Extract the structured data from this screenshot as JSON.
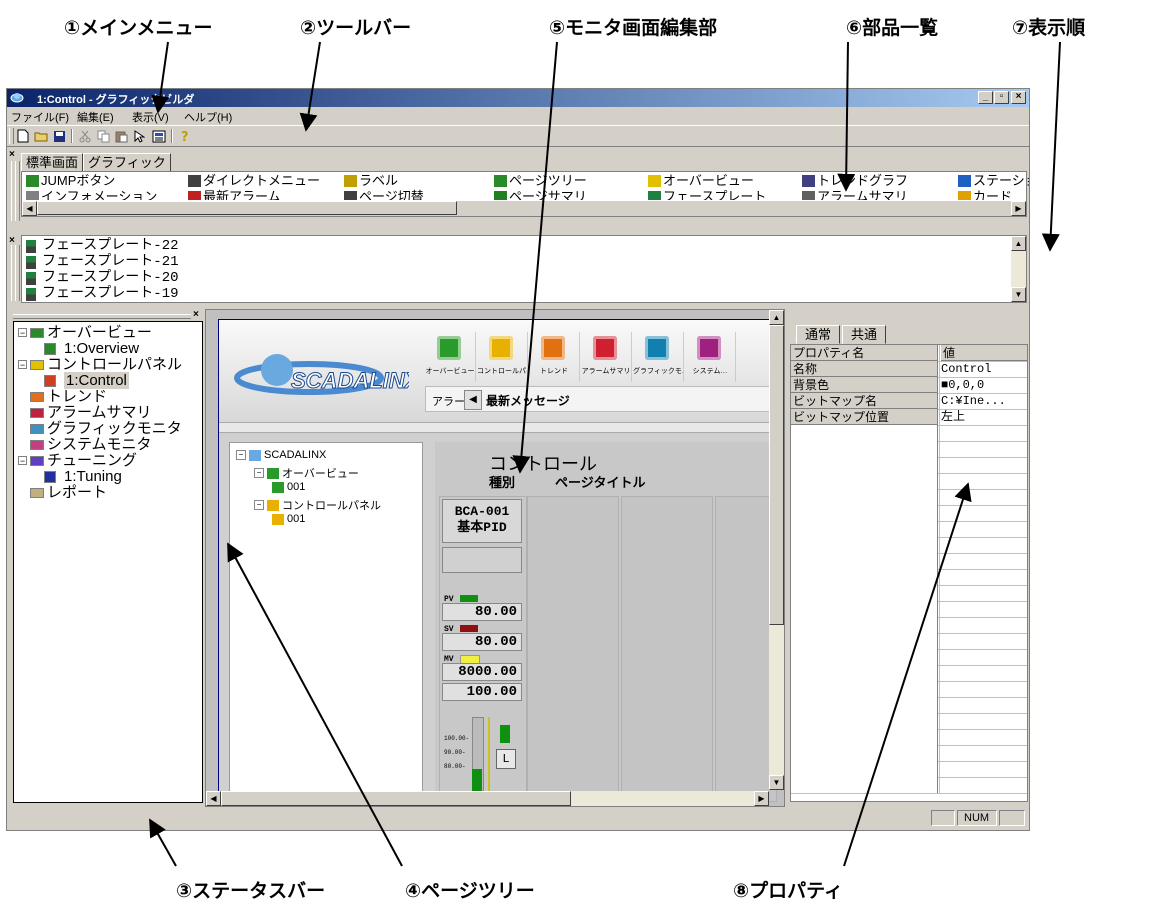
{
  "callouts": {
    "main_menu": "①メインメニュー",
    "toolbar": "②ツールバー",
    "monitor_editor": "⑤モニタ画面編集部",
    "parts_list": "⑥部品一覧",
    "display_order": "⑦表示順",
    "status_bar": "③ステータスバー",
    "page_tree": "④ページツリー",
    "properties": "⑧プロパティ"
  },
  "window": {
    "title": "1:Control - グラフィックビルダ",
    "controls": [
      "_",
      "▫",
      "×"
    ]
  },
  "menu": [
    "ファイル(F)",
    "編集(E)",
    "表示(V)",
    "ヘルプ(H)"
  ],
  "toolbar_icons": [
    "new-file-icon",
    "open-folder-icon",
    "save-icon",
    "cut-icon",
    "copy-icon",
    "paste-icon",
    "pointer-icon",
    "grid-icon",
    "help-icon"
  ],
  "parts": {
    "tabs": [
      "標準画面",
      "グラフィック"
    ],
    "items": [
      {
        "label": "JUMPボタン",
        "color": "#2a8a2a"
      },
      {
        "label": "ダイレクトメニュー",
        "color": "#404040"
      },
      {
        "label": "ラベル",
        "color": "#c0a000"
      },
      {
        "label": "ページツリー",
        "color": "#2a8a2a"
      },
      {
        "label": "オーバービュー",
        "color": "#e0c000"
      },
      {
        "label": "トレンドグラフ",
        "color": "#404080"
      },
      {
        "label": "ステーション",
        "color": "#2060c0"
      },
      {
        "label": "インフォメーション",
        "color": "#808080"
      },
      {
        "label": "最新アラーム",
        "color": "#c02020"
      },
      {
        "label": "ページ切替",
        "color": "#404040"
      },
      {
        "label": "ページサマリ",
        "color": "#208020"
      },
      {
        "label": "フェースプレート",
        "color": "#208040"
      },
      {
        "label": "アラームサマリ",
        "color": "#606060"
      },
      {
        "label": "カード",
        "color": "#e0a000"
      }
    ]
  },
  "order_list": [
    "フェースプレート-22",
    "フェースプレート-21",
    "フェースプレート-20",
    "フェースプレート-19"
  ],
  "page_tree": [
    {
      "label": "オーバービュー",
      "toggle": "⊟",
      "folder": "#2a8a2a",
      "level": 0
    },
    {
      "label": "1:Overview",
      "level": 1,
      "icon": "#2a8a2a"
    },
    {
      "label": "コントロールパネル",
      "toggle": "⊟",
      "folder": "#e0c000",
      "level": 0
    },
    {
      "label": "1:Control",
      "level": 1,
      "icon": "#d04020",
      "selected": true
    },
    {
      "label": "トレンド",
      "folder": "#e07020",
      "level": 0
    },
    {
      "label": "アラームサマリ",
      "folder": "#c02040",
      "level": 0
    },
    {
      "label": "グラフィックモニタ",
      "folder": "#4090c0",
      "level": 0
    },
    {
      "label": "システムモニタ",
      "folder": "#c04080",
      "level": 0
    },
    {
      "label": "チューニング",
      "toggle": "⊟",
      "folder": "#6040c0",
      "level": 0
    },
    {
      "label": "1:Tuning",
      "level": 1,
      "icon": "#2030a0"
    },
    {
      "label": "レポート",
      "folder": "#c0b080",
      "level": 0
    }
  ],
  "monitor": {
    "logo": "SCADALINX",
    "nav": [
      {
        "label": "オーバービュー",
        "color": "#2a9a2a"
      },
      {
        "label": "コントロールパネル",
        "color": "#e8b000"
      },
      {
        "label": "トレンド",
        "color": "#e07010"
      },
      {
        "label": "アラームサマリ",
        "color": "#d02030"
      },
      {
        "label": "グラフィックモニタ",
        "color": "#1080b0"
      },
      {
        "label": "システム…",
        "color": "#a02080"
      }
    ],
    "alarm_label": "アラーム",
    "alarm_message": "最新メッセージ",
    "tree": [
      {
        "label": "SCADALINX",
        "level": 0,
        "toggle": "⊟"
      },
      {
        "label": "オーバービュー",
        "level": 1,
        "toggle": "⊟"
      },
      {
        "label": "001",
        "level": 2
      },
      {
        "label": "コントロールパネル",
        "level": 1,
        "toggle": "⊟"
      },
      {
        "label": "001",
        "level": 2
      }
    ],
    "panel_title": "コントロール",
    "panel_kind": "種別",
    "panel_page_title": "ページタイトル",
    "faceplate": {
      "tag": "BCA-001",
      "type": "基本PID",
      "pv_label": "PV",
      "pv": "80.00",
      "sv_label": "SV",
      "sv": "80.00",
      "mv_label": "MV",
      "mv": "8000.00",
      "extra": "100.00",
      "scale": [
        "100.00-",
        "90.00-",
        "80.00-"
      ],
      "mode_btn": "L"
    }
  },
  "properties": {
    "tabs": [
      "通常",
      "共通"
    ],
    "header": {
      "name": "プロパティ名",
      "value": "値"
    },
    "rows": [
      {
        "name": "名称",
        "value": "Control"
      },
      {
        "name": "背景色",
        "value": "■0,0,0"
      },
      {
        "name": "ビットマップ名",
        "value": "C:¥Ine..."
      },
      {
        "name": "ビットマップ位置",
        "value": "左上"
      }
    ]
  },
  "status": {
    "num": "NUM"
  }
}
